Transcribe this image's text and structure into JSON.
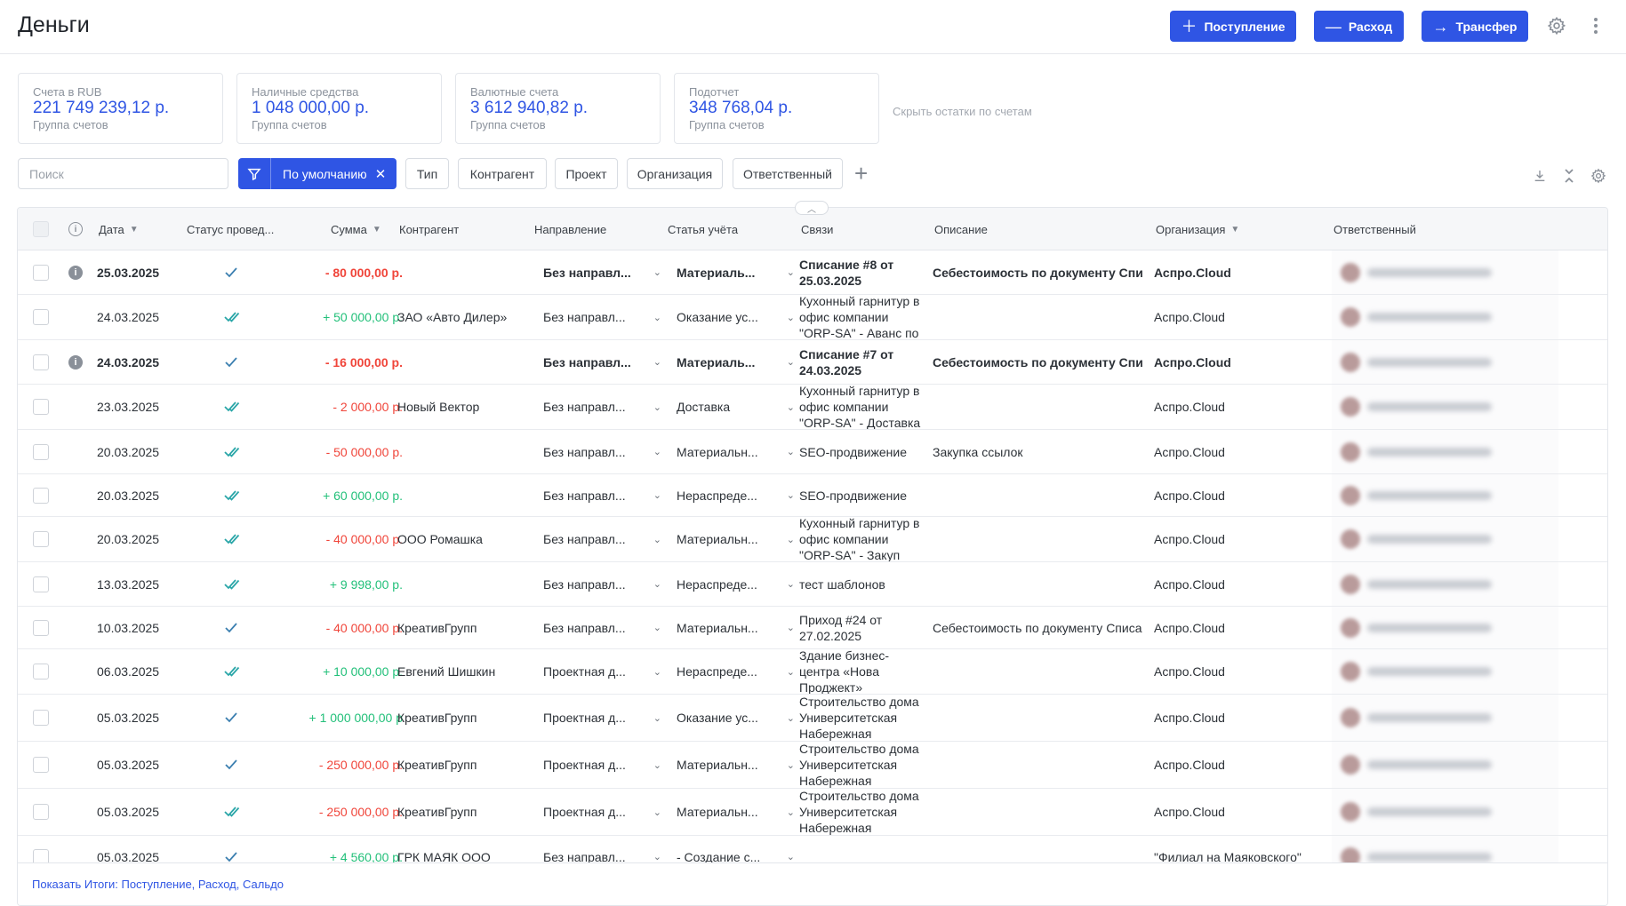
{
  "header": {
    "title": "Деньги",
    "buttons": {
      "income": "Поступление",
      "expense": "Расход",
      "transfer": "Трансфер"
    }
  },
  "balances": [
    {
      "label": "Счета в RUB",
      "value": "221 749 239,12 р.",
      "sub": "Группа счетов"
    },
    {
      "label": "Наличные средства",
      "value": "1 048 000,00 р.",
      "sub": "Группа счетов"
    },
    {
      "label": "Валютные счета",
      "value": "3 612 940,82 р.",
      "sub": "Группа счетов"
    },
    {
      "label": "Подотчет",
      "value": "348 768,04 р.",
      "sub": "Группа счетов"
    }
  ],
  "hide_balances": "Скрыть остатки по счетам",
  "filters": {
    "search_placeholder": "Поиск",
    "active": "По умолчанию",
    "chips": [
      "Тип",
      "Контрагент",
      "Проект",
      "Организация",
      "Ответственный"
    ]
  },
  "columns": {
    "date": "Дата",
    "status": "Статус провед...",
    "amount": "Сумма",
    "counterparty": "Контрагент",
    "direction": "Направление",
    "article": "Статья учёта",
    "links": "Связи",
    "description": "Описание",
    "organization": "Организация",
    "responsible": "Ответственный"
  },
  "colors": {
    "accent": "#2f55e4",
    "negative": "#f0453a",
    "positive": "#23c07a"
  },
  "rows": [
    {
      "info": true,
      "bold": true,
      "date": "25.03.2025",
      "status": "single",
      "amount": "- 80 000,00 р.",
      "sign": "neg",
      "counterparty": "",
      "direction": "Без направл...",
      "article": "Материаль...",
      "links": "Списание #8 от 25.03.2025",
      "description": "Себестоимость по документу Спис",
      "org": "Аспро.Cloud"
    },
    {
      "info": false,
      "bold": false,
      "date": "24.03.2025",
      "status": "double",
      "amount": "+ 50 000,00 р.",
      "sign": "pos",
      "counterparty": "ЗАО «Авто Дилер»",
      "direction": "Без направл...",
      "article": "Оказание ус...",
      "links": "Кухонный гарнитур в офис компании \"ORP-SA\" - Аванс по",
      "description": "",
      "org": "Аспро.Cloud"
    },
    {
      "info": true,
      "bold": true,
      "date": "24.03.2025",
      "status": "single",
      "amount": "- 16 000,00 р.",
      "sign": "neg",
      "counterparty": "",
      "direction": "Без направл...",
      "article": "Материаль...",
      "links": "Списание #7 от 24.03.2025",
      "description": "Себестоимость по документу Спис",
      "org": "Аспро.Cloud"
    },
    {
      "info": false,
      "bold": false,
      "date": "23.03.2025",
      "status": "double",
      "amount": "- 2 000,00 р.",
      "sign": "neg",
      "counterparty": "Новый Вектор",
      "direction": "Без направл...",
      "article": "Доставка",
      "links": "Кухонный гарнитур в офис компании \"ORP-SA\" - Доставка",
      "description": "",
      "org": "Аспро.Cloud"
    },
    {
      "info": false,
      "bold": false,
      "date": "20.03.2025",
      "status": "double",
      "amount": "- 50 000,00 р.",
      "sign": "neg",
      "counterparty": "",
      "direction": "Без направл...",
      "article": "Материальн...",
      "links": "SEO-продвижение",
      "description": "Закупка ссылок",
      "org": "Аспро.Cloud"
    },
    {
      "info": false,
      "bold": false,
      "date": "20.03.2025",
      "status": "double",
      "amount": "+ 60 000,00 р.",
      "sign": "pos",
      "counterparty": "",
      "direction": "Без направл...",
      "article": "Нераспреде...",
      "links": "SEO-продвижение",
      "description": "",
      "org": "Аспро.Cloud"
    },
    {
      "info": false,
      "bold": false,
      "date": "20.03.2025",
      "status": "double",
      "amount": "- 40 000,00 р.",
      "sign": "neg",
      "counterparty": "ООО Ромашка",
      "direction": "Без направл...",
      "article": "Материальн...",
      "links": "Кухонный гарнитур в офис компании \"ORP-SA\" - Закуп",
      "description": "",
      "org": "Аспро.Cloud"
    },
    {
      "info": false,
      "bold": false,
      "date": "13.03.2025",
      "status": "double",
      "amount": "+ 9 998,00 р.",
      "sign": "pos",
      "counterparty": "",
      "direction": "Без направл...",
      "article": "Нераспреде...",
      "links": "тест шаблонов",
      "description": "",
      "org": "Аспро.Cloud"
    },
    {
      "info": false,
      "bold": false,
      "date": "10.03.2025",
      "status": "single",
      "amount": "- 40 000,00 р.",
      "sign": "neg",
      "counterparty": "КреативГрупп",
      "direction": "Без направл...",
      "article": "Материальн...",
      "links": "Приход #24 от 27.02.2025",
      "description": "Себестоимость по документу Списа",
      "org": "Аспро.Cloud"
    },
    {
      "info": false,
      "bold": false,
      "date": "06.03.2025",
      "status": "double",
      "amount": "+ 10 000,00 р.",
      "sign": "pos",
      "counterparty": "Евгений Шишкин",
      "direction": "Проектная д...",
      "article": "Нераспреде...",
      "links": "Здание бизнес-центра «Нова Проджект»",
      "description": "",
      "org": "Аспро.Cloud"
    },
    {
      "info": false,
      "bold": false,
      "date": "05.03.2025",
      "status": "single",
      "amount": "+ 1 000 000,00 р",
      "sign": "pos",
      "counterparty": "КреативГрупп",
      "direction": "Проектная д...",
      "article": "Оказание ус...",
      "links": "Строительство дома Университетская Набережная",
      "description": "",
      "org": "Аспро.Cloud"
    },
    {
      "info": false,
      "bold": false,
      "date": "05.03.2025",
      "status": "single",
      "amount": "- 250 000,00 р.",
      "sign": "neg",
      "counterparty": "КреативГрупп",
      "direction": "Проектная д...",
      "article": "Материальн...",
      "links": "Строительство дома Университетская Набережная",
      "description": "",
      "org": "Аспро.Cloud"
    },
    {
      "info": false,
      "bold": false,
      "date": "05.03.2025",
      "status": "double",
      "amount": "- 250 000,00 р.",
      "sign": "neg",
      "counterparty": "КреативГрупп",
      "direction": "Проектная д...",
      "article": "Материальн...",
      "links": "Строительство дома Университетская Набережная",
      "description": "",
      "org": "Аспро.Cloud"
    },
    {
      "info": false,
      "bold": false,
      "date": "05.03.2025",
      "status": "single",
      "amount": "+ 4 560,00 р.",
      "sign": "pos",
      "counterparty": "ГРК МАЯК ООО",
      "direction": "Без направл...",
      "article": "- Создание с...",
      "links": "",
      "description": "",
      "org": "\"Филиал на Маяковского\""
    }
  ],
  "footer": {
    "totals_link": "Показать Итоги: Поступление, Расход, Сальдо"
  }
}
